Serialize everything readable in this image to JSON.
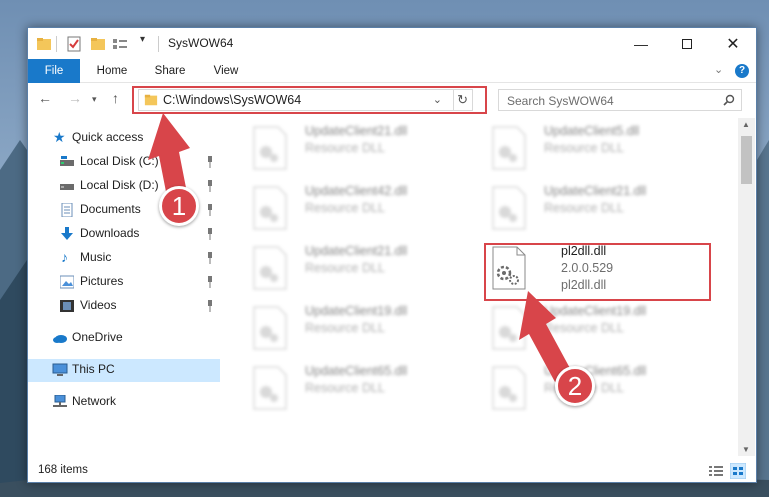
{
  "window": {
    "title": "SysWOW64"
  },
  "ribbon": {
    "tabs": [
      "File",
      "Home",
      "Share",
      "View"
    ]
  },
  "address": {
    "path": "C:\\Windows\\SysWOW64"
  },
  "search": {
    "placeholder": "Search SysWOW64"
  },
  "sidebar": {
    "items": [
      {
        "label": "Quick access",
        "icon": "star-icon"
      },
      {
        "label": "Local Disk (C:)",
        "icon": "drive-icon"
      },
      {
        "label": "Local Disk (D:)",
        "icon": "drive-icon"
      },
      {
        "label": "Documents",
        "icon": "documents-icon"
      },
      {
        "label": "Downloads",
        "icon": "download-icon"
      },
      {
        "label": "Music",
        "icon": "music-icon"
      },
      {
        "label": "Pictures",
        "icon": "pictures-icon"
      },
      {
        "label": "Videos",
        "icon": "videos-icon"
      },
      {
        "label": "OneDrive",
        "icon": "cloud-icon"
      },
      {
        "label": "This PC",
        "icon": "computer-icon"
      },
      {
        "label": "Network",
        "icon": "network-icon"
      }
    ]
  },
  "files": {
    "left": [
      {
        "name": "UpdateClient21.dll",
        "desc": "Resource DLL"
      },
      {
        "name": "UpdateClient42.dll",
        "desc": "Resource DLL"
      },
      {
        "name": "UpdateClient21.dll",
        "desc": "Resource DLL"
      },
      {
        "name": "UpdateClient19.dll",
        "desc": "Resource DLL"
      },
      {
        "name": "UpdateClient65.dll",
        "desc": "Resource DLL"
      }
    ],
    "right": [
      {
        "name": "UpdateClient5.dll",
        "desc": "Resource DLL"
      },
      {
        "name": "UpdateClient21.dll",
        "desc": "Resource DLL"
      },
      {
        "name": "pl2dll.dll",
        "version": "2.0.0.529",
        "desc": "pl2dll.dll"
      },
      {
        "name": "UpdateClient19.dll",
        "desc": "Resource DLL"
      },
      {
        "name": "UpdateClient65.dll",
        "desc": "Resource DLL"
      }
    ]
  },
  "status": {
    "count": "168 items"
  },
  "annotations": {
    "step1": "1",
    "step2": "2"
  },
  "colors": {
    "accent": "#1979ca",
    "highlight": "#d8454a",
    "selected": "#cce8ff"
  }
}
